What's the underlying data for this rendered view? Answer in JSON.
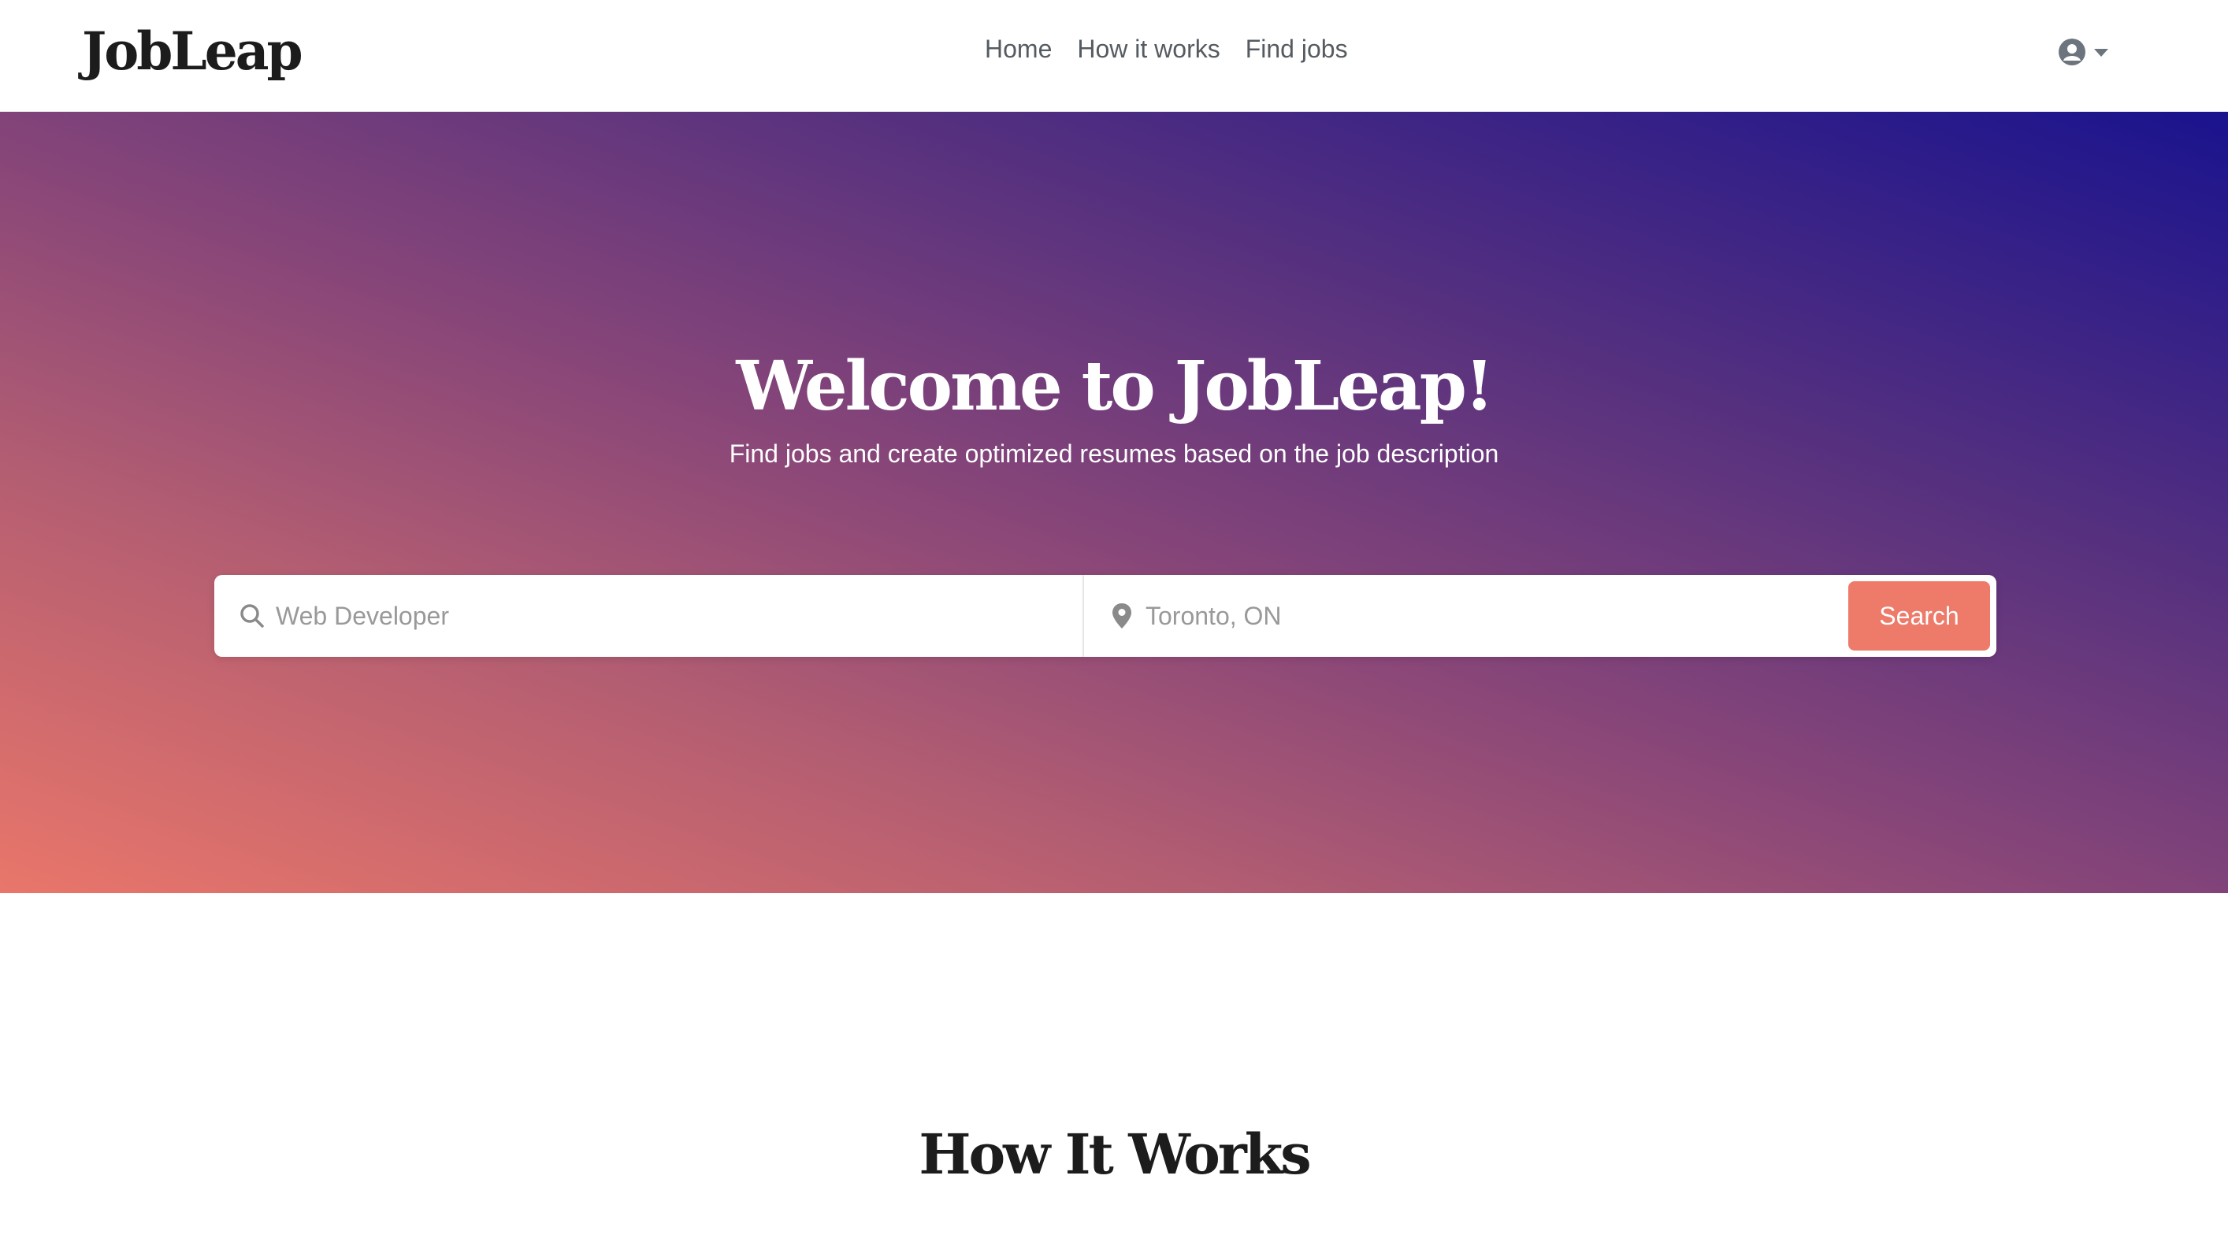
{
  "brand": "JobLeap",
  "nav": {
    "links": [
      {
        "label": "Home"
      },
      {
        "label": "How it works"
      },
      {
        "label": "Find jobs"
      }
    ],
    "user_icon": "user-circle-icon",
    "caret_icon": "caret-down-icon"
  },
  "hero": {
    "title": "Welcome to JobLeap!",
    "subtitle": "Find jobs and create optimized resumes based on the job description",
    "search": {
      "what_placeholder": "Web Developer",
      "where_placeholder": "Toronto, ON",
      "what_icon": "search-icon",
      "where_icon": "map-pin-icon",
      "button_label": "Search"
    }
  },
  "how_it_works": {
    "title": "How It Works"
  },
  "colors": {
    "accent": "#ee7a6a",
    "gradient_start": "#e9766a",
    "gradient_end": "#1a138e"
  }
}
